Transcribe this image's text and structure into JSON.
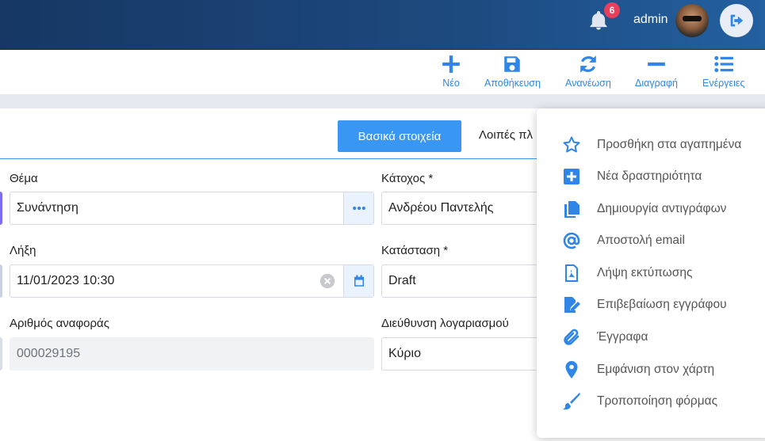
{
  "header": {
    "notification_count": "6",
    "username": "admin"
  },
  "toolbar": {
    "new_label": "Νέο",
    "save_label": "Αποθήκευση",
    "refresh_label": "Ανανέωση",
    "delete_label": "Διαγραφή",
    "actions_label": "Ενέργειες"
  },
  "tabs": {
    "basic": "Βασικά στοιχεία",
    "other": "Λοιπές πλ"
  },
  "form": {
    "subject_label": "Θέμα",
    "subject_value": "Συνάντηση",
    "owner_label": "Κάτοχος *",
    "owner_value": "Ανδρέου Παντελής",
    "expiry_label": "Λήξη",
    "expiry_value": "11/01/2023 10:30",
    "status_label": "Κατάσταση *",
    "status_value": "Draft",
    "reference_label": "Αριθμός αναφοράς",
    "reference_value": "000029195",
    "address_label": "Διεύθυνση λογαριασμού",
    "address_value": "Κύριο"
  },
  "actions_menu": {
    "items": [
      {
        "label": "Προσθήκη στα αγαπημένα",
        "icon": "star-icon"
      },
      {
        "label": "Νέα δραστηριότητα",
        "icon": "plus-square-icon"
      },
      {
        "label": "Δημιουργία αντιγράφων",
        "icon": "copy-icon"
      },
      {
        "label": "Αποστολή email",
        "icon": "at-icon"
      },
      {
        "label": "Λήψη εκτύπωσης",
        "icon": "pdf-file-icon"
      },
      {
        "label": "Επιβεβαίωση εγγράφου",
        "icon": "signature-icon"
      },
      {
        "label": "Έγγραφα",
        "icon": "paperclip-icon"
      },
      {
        "label": "Εμφάνιση στον χάρτη",
        "icon": "map-marker-icon"
      },
      {
        "label": "Τροποποίηση φόρμας",
        "icon": "paintbrush-icon"
      }
    ]
  },
  "colors": {
    "accent": "#3996f2",
    "header": "#1d4a7f",
    "badge": "#e8405c"
  }
}
